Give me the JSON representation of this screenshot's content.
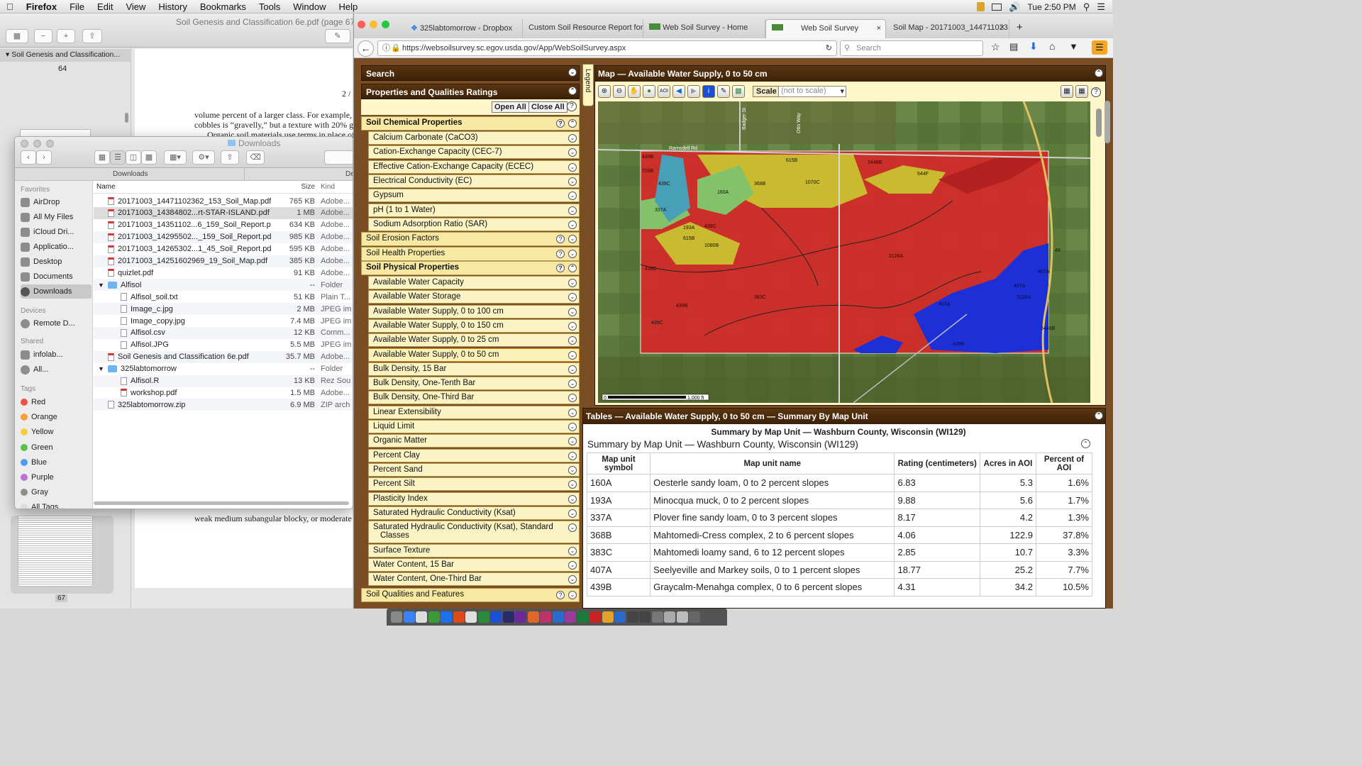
{
  "menubar": {
    "app": "Firefox",
    "items": [
      "File",
      "Edit",
      "View",
      "History",
      "Bookmarks",
      "Tools",
      "Window",
      "Help"
    ],
    "clock": "Tue 2:50 PM"
  },
  "preview": {
    "title": "Soil Genesis and Classification 6e.pdf (page 67",
    "sidebar_item": "Soil Genesis and Classification...",
    "page_top_num": "64",
    "page_bottom_num": "67",
    "page_number": "2 /",
    "text_lines": [
      "volume percent of a larger class. For example, a",
      "cobbles is “gravelly,” but a texture with 20% grav",
      "Organic soil materials use terms in place of a",
      "weak medium subangular blocky, or moderate th"
    ]
  },
  "finder": {
    "title": "Downloads",
    "tab_left": "Downloads",
    "tab_right": "De",
    "sidebar": {
      "favorites_header": "Favorites",
      "favorites": [
        "AirDrop",
        "All My Files",
        "iCloud Dri...",
        "Applicatio...",
        "Desktop",
        "Documents",
        "Downloads"
      ],
      "devices_header": "Devices",
      "devices": [
        "Remote D..."
      ],
      "shared_header": "Shared",
      "shared": [
        "infolab...",
        "All..."
      ],
      "tags_header": "Tags",
      "tags": [
        {
          "name": "Red",
          "color": "#f0514a"
        },
        {
          "name": "Orange",
          "color": "#f5a03a"
        },
        {
          "name": "Yellow",
          "color": "#f5cf3b"
        },
        {
          "name": "Green",
          "color": "#5ac04a"
        },
        {
          "name": "Blue",
          "color": "#4d9bf0"
        },
        {
          "name": "Purple",
          "color": "#bc72d6"
        },
        {
          "name": "Gray",
          "color": "#8e8e8e"
        },
        {
          "name": "All Tags...",
          "color": "#dddddd"
        }
      ]
    },
    "columns": {
      "name": "Name",
      "size": "Size",
      "kind": "Kind"
    },
    "files": [
      {
        "name": "20171003_14471102362_153_Soil_Map.pdf",
        "size": "765 KB",
        "kind": "Adobe...",
        "type": "pdf",
        "indent": 0
      },
      {
        "name": "20171003_14384802...rt-STAR-ISLAND.pdf",
        "size": "1 MB",
        "kind": "Adobe...",
        "type": "pdf",
        "indent": 0
      },
      {
        "name": "20171003_14351102...6_159_Soil_Report.pdf",
        "size": "634 KB",
        "kind": "Adobe...",
        "type": "pdf",
        "indent": 0
      },
      {
        "name": "20171003_14295502..._159_Soil_Report.pdf",
        "size": "985 KB",
        "kind": "Adobe...",
        "type": "pdf",
        "indent": 0
      },
      {
        "name": "20171003_14265302...1_45_Soil_Report.pdf",
        "size": "595 KB",
        "kind": "Adobe...",
        "type": "pdf",
        "indent": 0
      },
      {
        "name": "20171003_14251602969_19_Soil_Map.pdf",
        "size": "385 KB",
        "kind": "Adobe...",
        "type": "pdf",
        "indent": 0
      },
      {
        "name": "quizlet.pdf",
        "size": "91 KB",
        "kind": "Adobe...",
        "type": "pdf",
        "indent": 0
      },
      {
        "name": "Alfisol",
        "size": "--",
        "kind": "Folder",
        "type": "folder",
        "indent": 0
      },
      {
        "name": "Alfisol_soil.txt",
        "size": "51 KB",
        "kind": "Plain T...",
        "type": "gen",
        "indent": 1
      },
      {
        "name": "Image_c.jpg",
        "size": "2 MB",
        "kind": "JPEG im",
        "type": "gen",
        "indent": 1
      },
      {
        "name": "Image_copy.jpg",
        "size": "7.4 MB",
        "kind": "JPEG im",
        "type": "gen",
        "indent": 1
      },
      {
        "name": "Alfisol.csv",
        "size": "12 KB",
        "kind": "Comm...",
        "type": "gen",
        "indent": 1
      },
      {
        "name": "Alfisol.JPG",
        "size": "5.5 MB",
        "kind": "JPEG im",
        "type": "gen",
        "indent": 1
      },
      {
        "name": "Soil Genesis and Classification 6e.pdf",
        "size": "35.7 MB",
        "kind": "Adobe...",
        "type": "pdf",
        "indent": 0
      },
      {
        "name": "325labtomorrow",
        "size": "--",
        "kind": "Folder",
        "type": "folder",
        "indent": 0
      },
      {
        "name": "Alfisol.R",
        "size": "13 KB",
        "kind": "Rez Sou",
        "type": "gen",
        "indent": 1
      },
      {
        "name": "workshop.pdf",
        "size": "1.5 MB",
        "kind": "Adobe...",
        "type": "pdf",
        "indent": 1
      },
      {
        "name": "325labtomorrow.zip",
        "size": "6.9 MB",
        "kind": "ZIP arch",
        "type": "gen",
        "indent": 0
      }
    ]
  },
  "browser": {
    "tabs": [
      "325labtomorrow - Dropbox",
      "Custom Soil Resource Report for",
      "Web Soil Survey - Home",
      "Web Soil Survey",
      "Soil Map - 20171003_144711023"
    ],
    "active_tab": 3,
    "url": "https://websoilsurvey.sc.egov.usda.gov/App/WebSoilSurvey.aspx",
    "search_placeholder": "Search"
  },
  "wss": {
    "search_header": "Search",
    "props_header": "Properties and Qualities Ratings",
    "open_all": "Open All",
    "close_all": "Close All",
    "legend_tab": "Legend",
    "chem_header": "Soil Chemical Properties",
    "chem_items": [
      "Calcium Carbonate (CaCO3)",
      "Cation-Exchange Capacity (CEC-7)",
      "Effective Cation-Exchange Capacity (ECEC)",
      "Electrical Conductivity (EC)",
      "Gypsum",
      "pH (1 to 1 Water)",
      "Sodium Adsorption Ratio (SAR)"
    ],
    "erosion_header": "Soil Erosion Factors",
    "health_header": "Soil Health Properties",
    "phys_header": "Soil Physical Properties",
    "phys_items": [
      "Available Water Capacity",
      "Available Water Storage",
      "Available Water Supply, 0 to 100 cm",
      "Available Water Supply, 0 to 150 cm",
      "Available Water Supply, 0 to 25 cm",
      "Available Water Supply, 0 to 50 cm",
      "Bulk Density, 15 Bar",
      "Bulk Density, One-Tenth Bar",
      "Bulk Density, One-Third Bar",
      "Linear Extensibility",
      "Liquid Limit",
      "Organic Matter",
      "Percent Clay",
      "Percent Sand",
      "Percent Silt",
      "Plasticity Index",
      "Saturated Hydraulic Conductivity (Ksat)",
      "Saturated Hydraulic Conductivity (Ksat), Standard",
      "Surface Texture",
      "Water Content, 15 Bar",
      "Water Content, One-Third Bar"
    ],
    "phys_item_cont": "Classes",
    "qual_header": "Soil Qualities and Features",
    "map_header": "Map — Available Water Supply, 0 to 50 cm",
    "scale_label": "Scale",
    "scale_value": "(not to scale)",
    "scale_bar_left": "0",
    "scale_bar_right": "1,000 ft",
    "map_labels": [
      "439B",
      "726B",
      "439C",
      "160A",
      "337A",
      "193A",
      "615B",
      "439C",
      "1080B",
      "1070C",
      "544F",
      "3448B",
      "368B",
      "3128A",
      "407A",
      "407A",
      "3128A",
      "407A",
      "3448B",
      "439B",
      "383C",
      "439C",
      "439B",
      "439C",
      "615B",
      "Ramsdell Rd",
      "Badger St",
      "Otto Way",
      "49"
    ],
    "tables_header": "Tables — Available Water Supply, 0 to 50 cm — Summary By Map Unit",
    "summary_title_bold": "Summary by Map Unit — Washburn County, Wisconsin (WI129)",
    "summary_title": "Summary by Map Unit — Washburn County, Wisconsin (WI129)",
    "table_headers": [
      "Map unit symbol",
      "Map unit name",
      "Rating (centimeters)",
      "Acres in AOI",
      "Percent of AOI"
    ],
    "rows": [
      [
        "160A",
        "Oesterle sandy loam, 0 to 2 percent slopes",
        "6.83",
        "5.3",
        "1.6%"
      ],
      [
        "193A",
        "Minocqua muck, 0 to 2 percent slopes",
        "9.88",
        "5.6",
        "1.7%"
      ],
      [
        "337A",
        "Plover fine sandy loam, 0 to 3 percent slopes",
        "8.17",
        "4.2",
        "1.3%"
      ],
      [
        "368B",
        "Mahtomedi-Cress complex, 2 to 6 percent slopes",
        "4.06",
        "122.9",
        "37.8%"
      ],
      [
        "383C",
        "Mahtomedi loamy sand, 6 to 12 percent slopes",
        "2.85",
        "10.7",
        "3.3%"
      ],
      [
        "407A",
        "Seelyeville and Markey soils, 0 to 1 percent slopes",
        "18.77",
        "25.2",
        "7.7%"
      ],
      [
        "439B",
        "Graycalm-Menahga complex, 0 to 6 percent slopes",
        "4.31",
        "34.2",
        "10.5%"
      ]
    ],
    "colors": {
      "red": "#d42a28",
      "yellow": "#c8c230",
      "green": "#83c26b",
      "teal": "#47a0b8",
      "blue": "#1d2fd6"
    }
  }
}
